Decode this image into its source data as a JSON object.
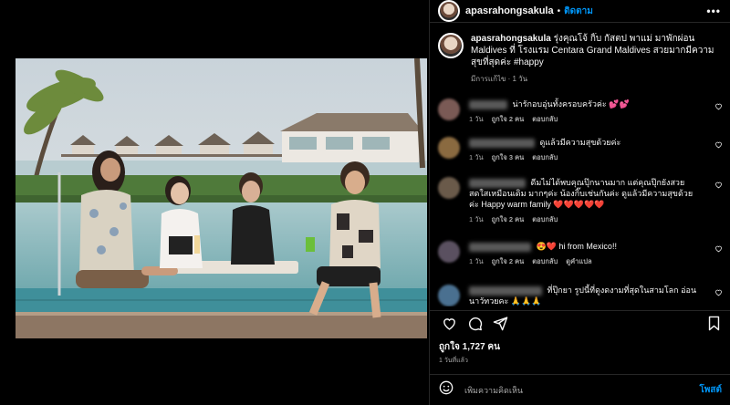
{
  "post": {
    "username": "apasrahongsakula",
    "follow_label": "ติดตาม",
    "more_label": "•••",
    "caption_user": "apasrahongsakula",
    "caption_text": "รุ่งคุณโจ้ กิ๊บ กัสตป พาแม่ มาพักผ่อน Maldives ที่ โรงแรม Centara Grand Maldives สวยมากมีความสุขที่สุดค่ะ #happy",
    "caption_meta": "มีการแก้ไข · 1 วัน"
  },
  "comments": [
    {
      "text": "น่ารักอบอุ่นทั้งครอบครัวค่ะ 💕💕",
      "time": "1 วัน",
      "likes": "ถูกใจ 2 คน",
      "reply": "ตอบกลับ",
      "avatar_color": "#7a5a55"
    },
    {
      "text": "ดูแล้วมีความสุขด้วยค่ะ",
      "time": "1 วัน",
      "likes": "ถูกใจ 3 คน",
      "reply": "ตอบกลับ",
      "avatar_color": "#8a6a40"
    },
    {
      "text": "ดีมไม่ได้พบคุณปุ๊กนานมาก แต่คุณปุ๊กยังสวยสดใสเหมือนเดิม มากๆค่ะ น้องกิ๊บเช่นกันค่ะ ดูแล้วมีความสุขด้วยค่ะ Happy warm family ❤️❤️❤️❤️❤️",
      "time": "1 วัน",
      "likes": "ถูกใจ 2 คน",
      "reply": "ตอบกลับ",
      "avatar_color": "#6a5a4a"
    },
    {
      "text": "😍❤️ hi from Mexico!!",
      "time": "1 วัน",
      "likes": "ถูกใจ 2 คน",
      "reply": "ตอบกลับ",
      "translate": "ดูคำแปล",
      "avatar_color": "#5a5060"
    },
    {
      "text": "ที่ปุ๊กยา รูปนี้ที่ดูงดงามที่สุดในสามโลก อ่อน นาวัทวยคะ 🙏🙏🙏",
      "time": "",
      "likes": "",
      "reply": "",
      "avatar_color": "#4a7090"
    }
  ],
  "actions": {
    "like_icon": "heart-icon",
    "comment_icon": "comment-icon",
    "share_icon": "share-icon",
    "save_icon": "bookmark-icon"
  },
  "likes_label": "ถูกใจ 1,727 คน",
  "time_ago": "1 วันที่แล้ว",
  "add_comment": {
    "placeholder": "เพิ่มความคิดเห็น",
    "post_label": "โพสต์",
    "emoji_icon": "emoji-icon"
  },
  "colors": {
    "accent": "#0095f6",
    "background": "#000000",
    "muted": "#a8a8a8"
  }
}
